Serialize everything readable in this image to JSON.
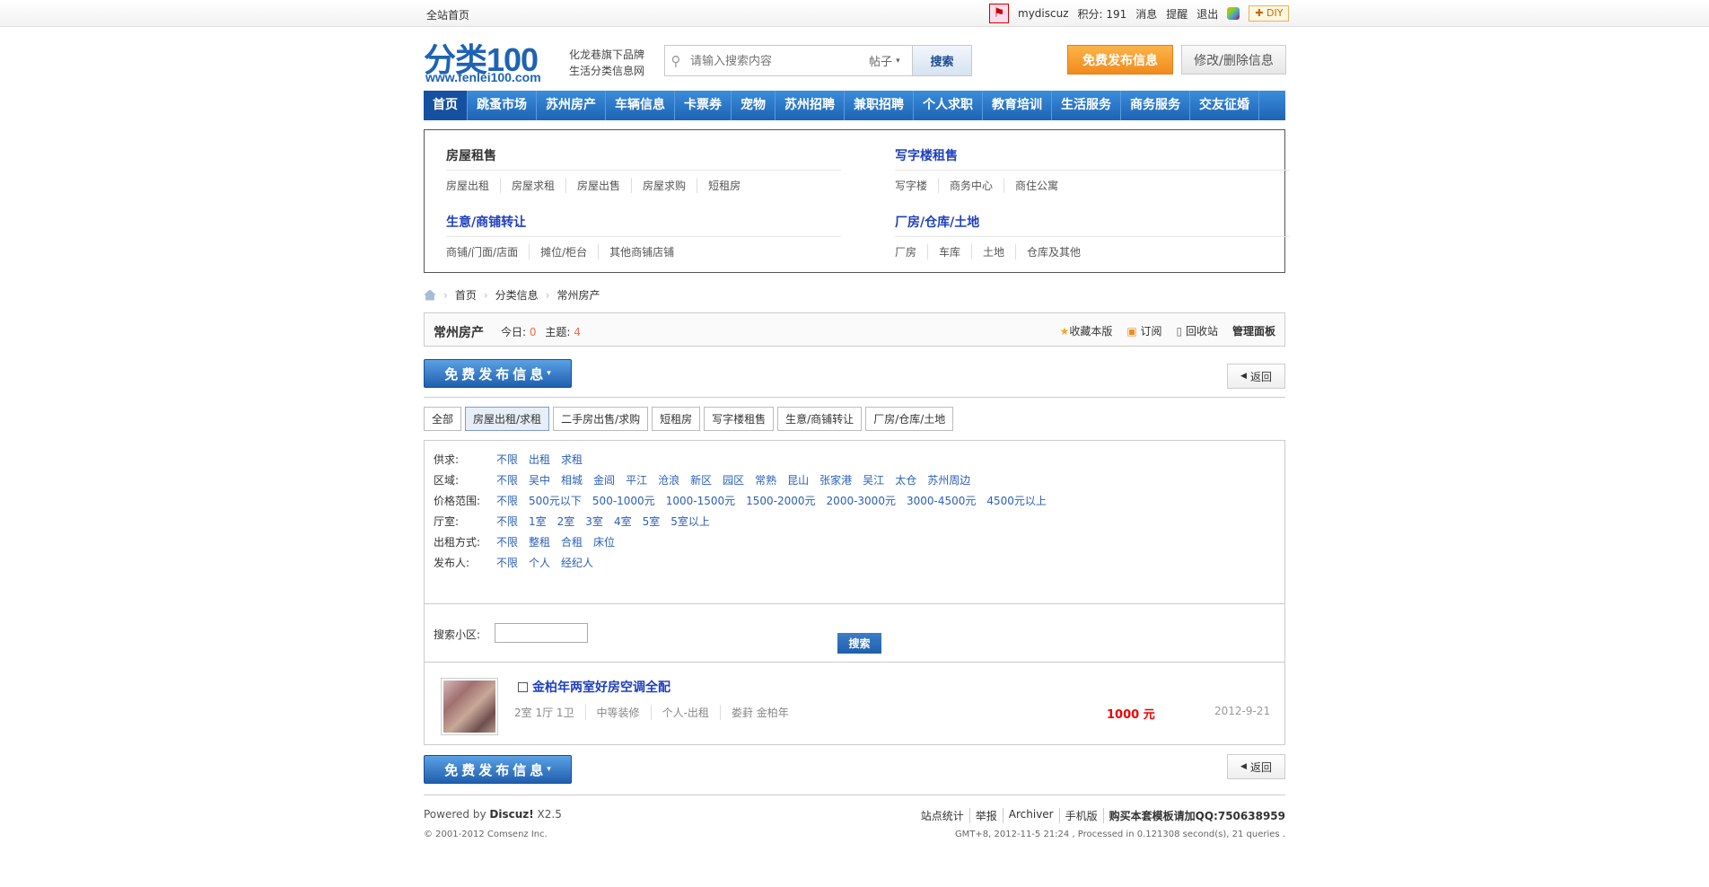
{
  "topbar": {
    "home": "全站首页",
    "username": "mydiscuz",
    "points_label": "积分: 191",
    "messages": "消息",
    "reminders": "提醒",
    "logout": "退出",
    "diy": "DIY"
  },
  "header": {
    "logo_text": "分类100",
    "logo_url": "www.fenlei100.com",
    "slogan_line1": "化龙巷旗下品牌",
    "slogan_line2": "生活分类信息网",
    "search_placeholder": "请输入搜索内容",
    "search_scope": "帖子",
    "search_button": "搜索",
    "post_button": "免费发布信息",
    "modify_button": "修改/删除信息"
  },
  "nav": [
    "首页",
    "跳蚤市场",
    "苏州房产",
    "车辆信息",
    "卡票券",
    "宠物",
    "苏州招聘",
    "兼职招聘",
    "个人求职",
    "教育培训",
    "生活服务",
    "商务服务",
    "交友征婚"
  ],
  "menu": {
    "groups": [
      {
        "title": "房屋租售",
        "links": [
          "房屋出租",
          "房屋求租",
          "房屋出售",
          "房屋求购",
          "短租房"
        ]
      },
      {
        "title": "写字楼租售",
        "links": [
          "写字楼",
          "商务中心",
          "商住公寓"
        ]
      },
      {
        "title": "生意/商铺转让",
        "links": [
          "商铺/门面/店面",
          "摊位/柜台",
          "其他商铺店铺"
        ]
      },
      {
        "title": "厂房/仓库/土地",
        "links": [
          "厂房",
          "车库",
          "土地",
          "仓库及其他"
        ]
      }
    ]
  },
  "breadcrumb": [
    "首页",
    "分类信息",
    "常州房产"
  ],
  "forum": {
    "title": "常州房产",
    "today_label": "今日:",
    "today_value": "0",
    "threads_label": "主题:",
    "threads_value": "4",
    "actions": [
      "收藏本版",
      "订阅",
      "回收站",
      "管理面板"
    ]
  },
  "post_btn": "免费发布信息",
  "back_btn": "返回",
  "tabs": [
    "全部",
    "房屋出租/求租",
    "二手房出售/求购",
    "短租房",
    "写字楼租售",
    "生意/商铺转让",
    "厂房/仓库/土地"
  ],
  "filters": [
    {
      "label": "供求:",
      "options": [
        "不限",
        "出租",
        "求租"
      ]
    },
    {
      "label": "区域:",
      "options": [
        "不限",
        "吴中",
        "相城",
        "金阊",
        "平江",
        "沧浪",
        "新区",
        "园区",
        "常熟",
        "昆山",
        "张家港",
        "吴江",
        "太仓",
        "苏州周边"
      ]
    },
    {
      "label": "价格范围:",
      "options": [
        "不限",
        "500元以下",
        "500-1000元",
        "1000-1500元",
        "1500-2000元",
        "2000-3000元",
        "3000-4500元",
        "4500元以上"
      ]
    },
    {
      "label": "厅室:",
      "options": [
        "不限",
        "1室",
        "2室",
        "3室",
        "4室",
        "5室",
        "5室以上"
      ]
    },
    {
      "label": "出租方式:",
      "options": [
        "不限",
        "整租",
        "合租",
        "床位"
      ]
    },
    {
      "label": "发布人:",
      "options": [
        "不限",
        "个人",
        "经纪人"
      ]
    }
  ],
  "search_area": {
    "label": "搜索小区:",
    "button": "搜索"
  },
  "listing": {
    "title": "金柏年两室好房空调全配",
    "meta": [
      "2室 1厅 1卫",
      "中等装修",
      "个人-出租",
      "娄葑 金柏年"
    ],
    "price": "1000 元",
    "date": "2012-9-21"
  },
  "footer": {
    "powered_prefix": "Powered by ",
    "powered_brand": "Discuz!",
    "powered_ver": " X2.5",
    "copyright": "© 2001-2012 Comsenz Inc.",
    "links": [
      "站点统计",
      "举报",
      "Archiver",
      "手机版"
    ],
    "qq": "购买本套模板请加QQ:750638959",
    "gmt": "GMT+8, 2012-11-5 21:24 , Processed in 0.121308 second(s), 21 queries ."
  },
  "colors": {
    "nav": "#1e63b4",
    "accent_orange": "#f28a1d",
    "price": "#e00000",
    "link": "#2b5fb8"
  }
}
